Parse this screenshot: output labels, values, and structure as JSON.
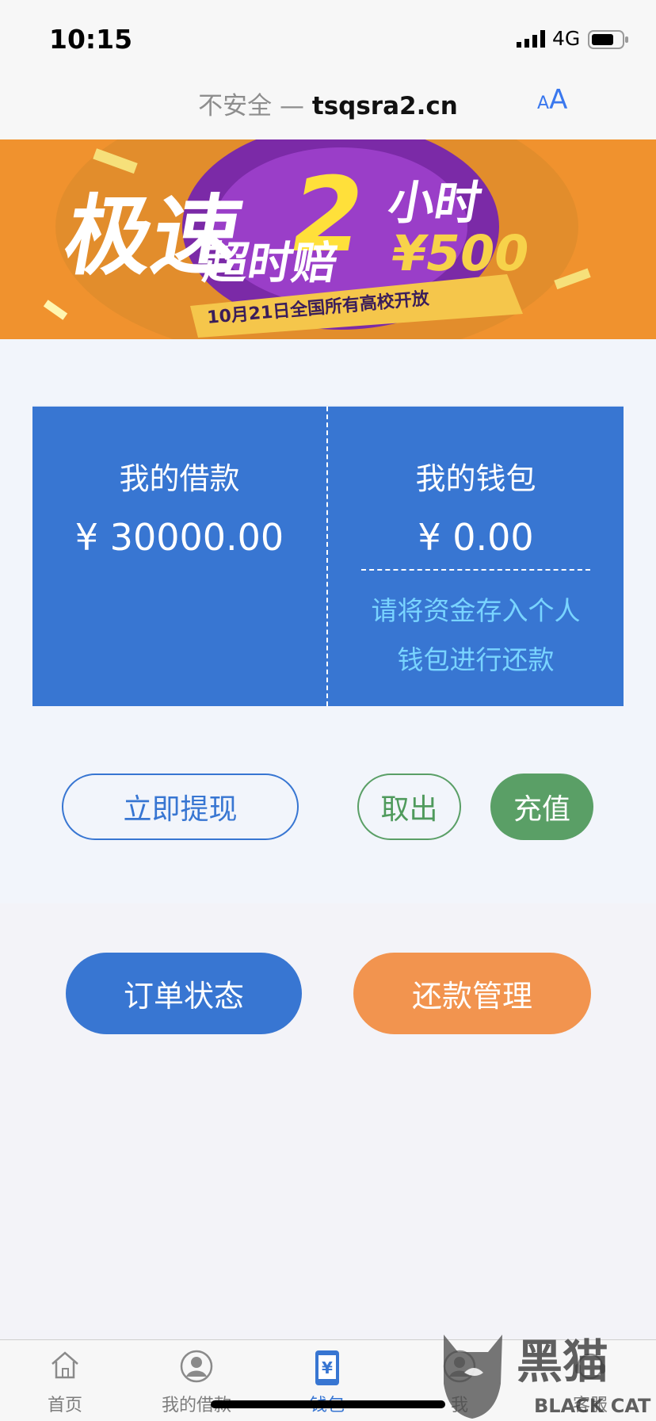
{
  "status_bar": {
    "time": "10:15",
    "network": "4G"
  },
  "url_bar": {
    "prefix": "不安全 — ",
    "domain": "tsqsra2.cn",
    "text_size_small": "A",
    "text_size_large": "A"
  },
  "banner": {
    "headline_1": "极速",
    "headline_number": "2",
    "headline_2": "小时",
    "headline_3": "超时赔",
    "amount": "¥500",
    "ribbon": "10月21日全国所有高校开放"
  },
  "card": {
    "loan_label": "我的借款",
    "loan_amount": "¥ 30000.00",
    "wallet_label": "我的钱包",
    "wallet_amount": "¥ 0.00",
    "wallet_tip_line1": "请将资金存入个人",
    "wallet_tip_line2": "钱包进行还款"
  },
  "actions": {
    "withdraw": "立即提现",
    "takeout": "取出",
    "recharge": "充值"
  },
  "bottom_actions": {
    "order_status": "订单状态",
    "repay_manage": "还款管理"
  },
  "tabs": [
    {
      "label": "首页",
      "icon": "home-icon"
    },
    {
      "label": "我的借款",
      "icon": "user-icon"
    },
    {
      "label": "钱包",
      "icon": "wallet-phone-icon",
      "active": true
    },
    {
      "label": "我",
      "icon": "profile-icon"
    },
    {
      "label": "客服",
      "icon": "support-icon"
    }
  ],
  "watermark": {
    "text_cn": "黑猫",
    "text_en": "BLACK CAT"
  },
  "colors": {
    "primary": "#3876d2",
    "green": "#5a9f66",
    "orange": "#f2944f",
    "banner": "#f0922e",
    "tip": "#79d4ff"
  }
}
